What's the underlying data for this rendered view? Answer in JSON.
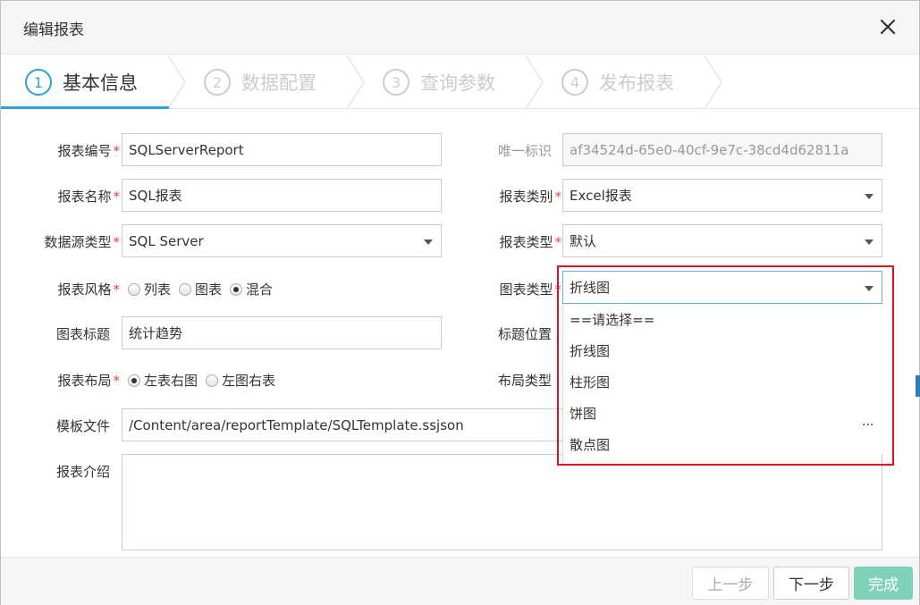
{
  "dialog": {
    "title": "编辑报表",
    "close_icon": "close-icon"
  },
  "steps": [
    {
      "number": "1",
      "label": "基本信息",
      "active": true
    },
    {
      "number": "2",
      "label": "数据配置",
      "active": false
    },
    {
      "number": "3",
      "label": "查询参数",
      "active": false
    },
    {
      "number": "4",
      "label": "发布报表",
      "active": false
    }
  ],
  "form": {
    "report_code": {
      "label": "报表编号",
      "value": "SQLServerReport"
    },
    "report_name": {
      "label": "报表名称",
      "value": "SQL报表"
    },
    "datasource_type": {
      "label": "数据源类型",
      "value": "SQL Server"
    },
    "report_style": {
      "label": "报表风格",
      "options": [
        "列表",
        "图表",
        "混合"
      ],
      "selected": "混合"
    },
    "chart_title": {
      "label": "图表标题",
      "value": "统计趋势"
    },
    "report_layout": {
      "label": "报表布局",
      "options": [
        "左表右图",
        "左图右表"
      ],
      "selected": "左表右图"
    },
    "template_file": {
      "label": "模板文件",
      "value": "/Content/area/reportTemplate/SQLTemplate.ssjson"
    },
    "description": {
      "label": "报表介绍",
      "value": ""
    },
    "unique_id": {
      "label": "唯一标识",
      "value": "af34524d-65e0-40cf-9e7c-38cd4d62811a"
    },
    "report_category": {
      "label": "报表类别",
      "value": "Excel报表"
    },
    "report_type": {
      "label": "报表类型",
      "value": "默认"
    },
    "chart_type": {
      "label": "图表类型",
      "value": "折线图",
      "options": [
        "==请选择==",
        "折线图",
        "柱形图",
        "饼图",
        "散点图"
      ]
    },
    "title_position": {
      "label": "标题位置"
    },
    "layout_type": {
      "label": "布局类型"
    },
    "required_mark": "*",
    "ellipsis": "..."
  },
  "footer": {
    "prev_label": "上一步",
    "next_label": "下一步",
    "done_label": "完成"
  },
  "colors": {
    "accent": "#2f9fd9",
    "highlight": "#d9121b",
    "done": "#7fd1b9",
    "required": "#e84141"
  }
}
